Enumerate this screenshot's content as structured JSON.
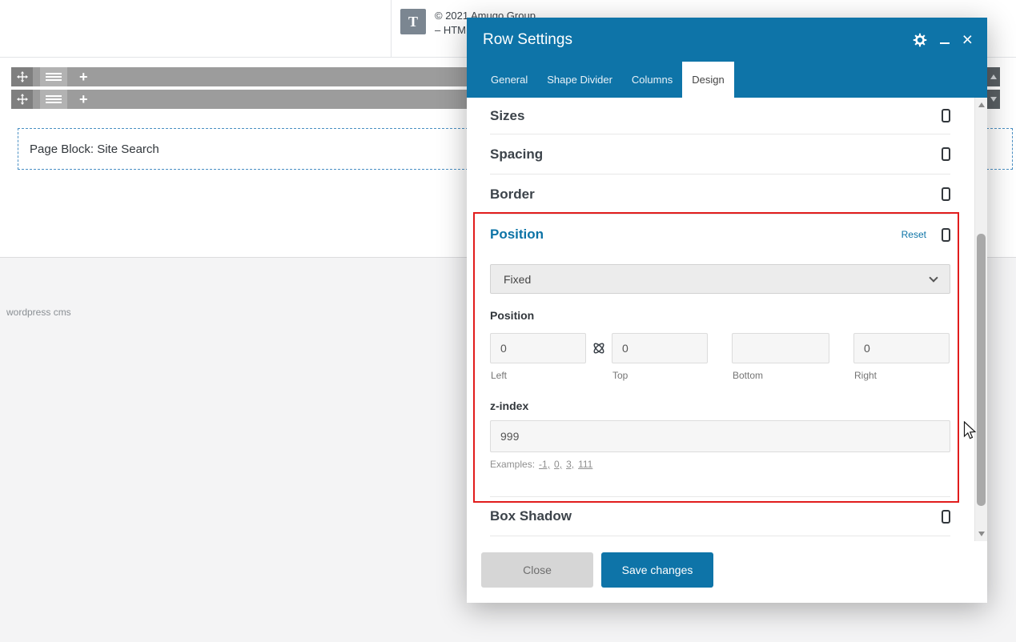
{
  "colors": {
    "header_blue": "#0e74a8",
    "accent_blue": "#0c73a6",
    "annotation_red": "#e11c1c",
    "toolbar_gray": "#9c9c9c",
    "close_button_bg": "#d6d6d6"
  },
  "canvas": {
    "text_block": {
      "icon_letter": "T",
      "line1": "© 2021 Amugo Group",
      "line2": "– HTM"
    },
    "toolbar": {
      "plus": "+"
    },
    "page_block_label": "Page Block: Site Search",
    "watermark": "wordpress cms"
  },
  "modal": {
    "title": "Row Settings",
    "header_icons": {
      "close": "×"
    },
    "tabs": [
      {
        "label": "General"
      },
      {
        "label": "Shape Divider"
      },
      {
        "label": "Columns"
      },
      {
        "label": "Design"
      }
    ],
    "active_tab": "Design",
    "sections": {
      "sizes": "Sizes",
      "spacing": "Spacing",
      "border": "Border",
      "position": "Position",
      "box_shadow": "Box Shadow"
    },
    "position_panel": {
      "reset_label": "Reset",
      "dropdown_value": "Fixed",
      "group_label": "Position",
      "fields": [
        {
          "value": "0",
          "label": "Left"
        },
        {
          "value": "0",
          "label": "Top"
        },
        {
          "value": "",
          "label": "Bottom"
        },
        {
          "value": "0",
          "label": "Right"
        }
      ],
      "zindex_label": "z-index",
      "zindex_value": "999",
      "examples_label": "Examples:",
      "examples": [
        "-1,",
        "0,",
        "3,",
        "111"
      ]
    },
    "footer": {
      "close_label": "Close",
      "save_label": "Save changes"
    }
  }
}
